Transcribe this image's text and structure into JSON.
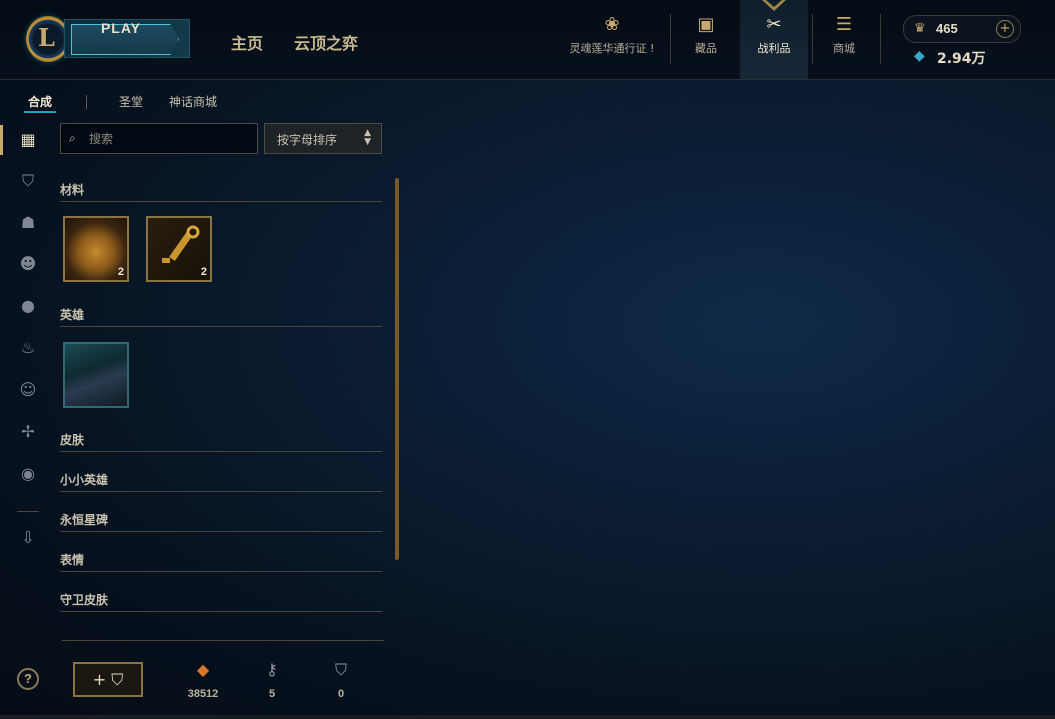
{
  "header": {
    "play_label": "PLAY",
    "nav_home": "主页",
    "nav_tft": "云顶之弈",
    "icons": [
      {
        "label": "灵魂莲华通行证 !",
        "icon": "lotus-icon"
      },
      {
        "label": "藏品",
        "icon": "backpack-icon"
      },
      {
        "label": "战利品",
        "icon": "loot-icon"
      },
      {
        "label": "商城",
        "icon": "coins-icon"
      }
    ],
    "rp_value": "465",
    "be_value": "2.94万"
  },
  "subtabs": [
    "合成",
    "圣堂",
    "神话商城"
  ],
  "search": {
    "placeholder": "搜索"
  },
  "sort": {
    "label": "按字母排序"
  },
  "sections": [
    {
      "title": "材料"
    },
    {
      "title": "英雄"
    },
    {
      "title": "皮肤"
    },
    {
      "title": "小小英雄"
    },
    {
      "title": "永恒星碑"
    },
    {
      "title": "表情"
    },
    {
      "title": "守卫皮肤"
    }
  ],
  "materials": [
    {
      "name": "hextech-chest",
      "count": "2"
    },
    {
      "name": "hextech-key",
      "count": "2"
    }
  ],
  "footer": {
    "orange_essence": "38512",
    "keys": "5",
    "chests": "0"
  },
  "colors": {
    "gold": "#c8aa6e",
    "accent_blue": "#1aa3c4",
    "text": "#c8c1ae"
  }
}
